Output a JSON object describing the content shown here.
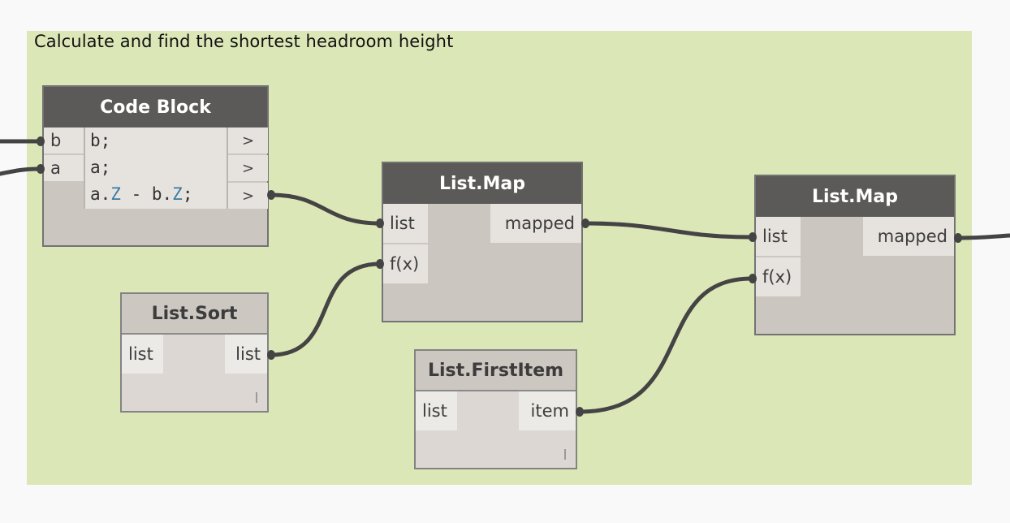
{
  "group": {
    "title": "Calculate and find the shortest headroom height",
    "color": "#dce7b7"
  },
  "nodes": {
    "code_block": {
      "title": "Code Block",
      "inputs": [
        "b",
        "a"
      ],
      "code_lines": [
        {
          "parts": [
            {
              "t": "b;",
              "k": "plain"
            }
          ]
        },
        {
          "parts": [
            {
              "t": "a;",
              "k": "plain"
            }
          ]
        },
        {
          "parts": [
            {
              "t": "a.",
              "k": "plain"
            },
            {
              "t": "Z",
              "k": "prop"
            },
            {
              "t": " - b.",
              "k": "plain"
            },
            {
              "t": "Z",
              "k": "prop"
            },
            {
              "t": ";",
              "k": "plain"
            }
          ]
        }
      ],
      "output_symbol": ">"
    },
    "list_map_1": {
      "title": "List.Map",
      "inputs": [
        "list",
        "f(x)"
      ],
      "outputs": [
        "mapped"
      ]
    },
    "list_sort": {
      "title": "List.Sort",
      "inputs": [
        "list"
      ],
      "outputs": [
        "list"
      ],
      "lacing_mark": "l"
    },
    "list_first_item": {
      "title": "List.FirstItem",
      "inputs": [
        "list"
      ],
      "outputs": [
        "item"
      ],
      "lacing_mark": "l"
    },
    "list_map_2": {
      "title": "List.Map",
      "inputs": [
        "list",
        "f(x)"
      ],
      "outputs": [
        "mapped"
      ]
    }
  },
  "wires": [
    {
      "from": "external",
      "to": "code_block.b"
    },
    {
      "from": "external",
      "to": "code_block.a"
    },
    {
      "from": "code_block.out3",
      "to": "list_map_1.list"
    },
    {
      "from": "list_sort.list",
      "to": "list_map_1.f(x)"
    },
    {
      "from": "list_map_1.mapped",
      "to": "list_map_2.list"
    },
    {
      "from": "list_first_item.item",
      "to": "list_map_2.f(x)"
    },
    {
      "from": "list_map_2.mapped",
      "to": "external"
    }
  ],
  "colors": {
    "background": "#f9f9f9",
    "node_header_dark": "#5c5a59",
    "node_body": "#cbc6c0",
    "wire": "#444444",
    "code_property": "#3c7aa3"
  }
}
